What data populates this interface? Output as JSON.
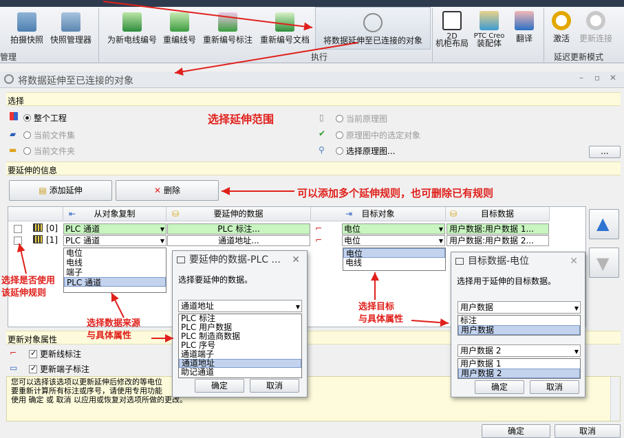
{
  "ribbon": {
    "buttons": [
      "拍摄快照",
      "快照管理器",
      "为新电线编号",
      "重编线号",
      "重新编号标注",
      "重新编号文档",
      "将数据延伸至已连接的对象",
      "2D",
      "机柜布局",
      "PTC Creo",
      "装配体",
      "翻译",
      "激活",
      "更新连接"
    ],
    "groups": [
      "管理",
      "执行",
      "延迟更新模式"
    ]
  },
  "window": {
    "title": "将数据延伸至已连接的对象"
  },
  "scope": {
    "section": "选择",
    "whole_project": "整个工程",
    "current_fileset": "当前文件集",
    "current_folder": "当前文件夹",
    "current_schematic": "当前原理图",
    "selected_in_schematic": "原理图中的选定对象",
    "choose_schematic": "选择原理图...",
    "browse": "..."
  },
  "info": {
    "section": "要延伸的信息",
    "add": "添加延伸",
    "delete": "删除"
  },
  "grid": {
    "headers": [
      "从对象复制",
      "要延伸的数据",
      "目标对象",
      "目标数据"
    ],
    "rows": [
      {
        "index": "[0]",
        "source": "PLC 通道",
        "data": "PLC 标注...",
        "target": "电位",
        "target_data": "用户数据:用户数据 1..."
      },
      {
        "index": "[1]",
        "source": "PLC 通道",
        "data": "通道地址...",
        "target": "电位",
        "target_data": "用户数据:用户数据 2..."
      }
    ],
    "source_options": [
      "电位",
      "电线",
      "端子",
      "PLC 通道"
    ],
    "target_options": [
      "电位",
      "电线"
    ]
  },
  "update": {
    "section": "更新对象属性",
    "wire_labels": "更新线标注",
    "terminal_labels": "更新端子标注",
    "desc1": "您可以选择该选项以更新延伸后修改的等电位",
    "desc2": "要重新计算所有标注或序号，请使用专用功能",
    "desc3": "使用 确定 或 取消 以应用或恢复对选项所做的更改。",
    "ok": "确定",
    "cancel": "取消"
  },
  "dlg_data": {
    "title": "要延伸的数据-PLC ...",
    "prompt": "选择要延伸的数据。",
    "selected": "通道地址",
    "options": [
      "PLC 标注",
      "PLC 用户数据",
      "PLC 制造商数据",
      "PLC 序号",
      "通道端子",
      "通道地址",
      "助记通道"
    ],
    "ok": "确定",
    "cancel": "取消"
  },
  "dlg_target": {
    "title": "目标数据-电位",
    "prompt": "选择用于延伸的目标数据。",
    "selected1": "用户数据",
    "options1": [
      "标注",
      "用户数据"
    ],
    "selected2": "用户数据 2",
    "options2": [
      "用户数据 1",
      "用户数据 2"
    ],
    "ok": "确定",
    "cancel": "取消"
  },
  "annotations": {
    "scope": "选择延伸范围",
    "rules": "可以添加多个延伸规则，也可删除已有规则",
    "use1": "选择是否使用",
    "use2": "该延伸规则",
    "src1": "选择数据来源",
    "src2": "与具体属性",
    "tgt1": "选择目标",
    "tgt2": "与具体属性"
  },
  "colors": {
    "annotation": "#e0201b",
    "highlight": "#c3d3ee",
    "green_cell": "#c8f5c0"
  }
}
